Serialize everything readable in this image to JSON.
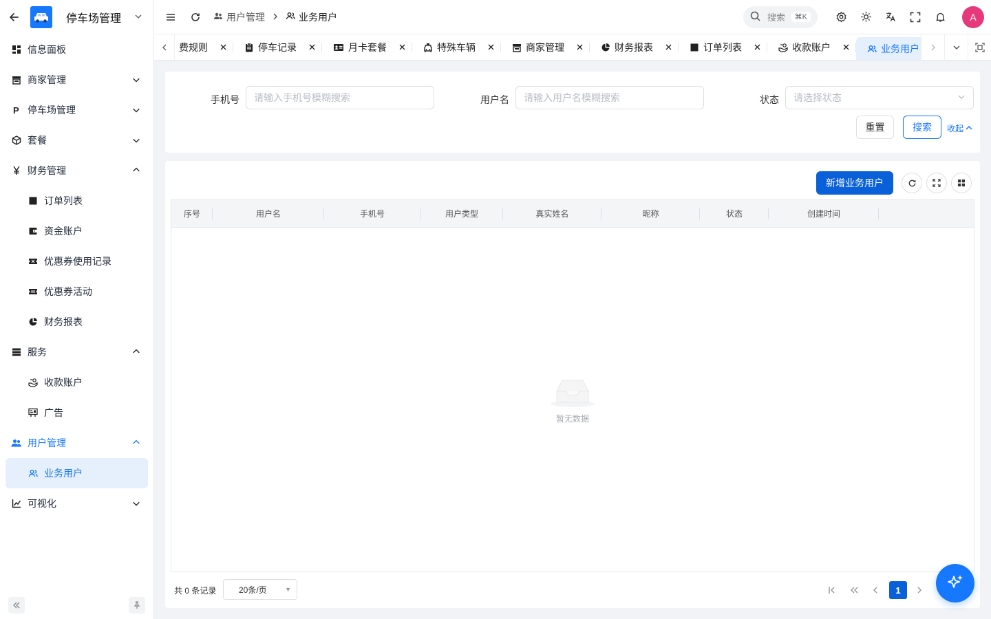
{
  "app": {
    "title": "停车场管理"
  },
  "sidebar": {
    "items": [
      {
        "label": "信息面板",
        "icon": "dashboard-icon"
      },
      {
        "label": "商家管理",
        "icon": "store-icon",
        "expandable": true,
        "expanded": false
      },
      {
        "label": "停车场管理",
        "icon": "parking-icon",
        "expandable": true,
        "expanded": false
      },
      {
        "label": "套餐",
        "icon": "package-icon",
        "expandable": true,
        "expanded": false
      },
      {
        "label": "财务管理",
        "icon": "yuan-icon",
        "expandable": true,
        "expanded": true
      },
      {
        "label": "订单列表",
        "icon": "square-icon",
        "sub": true
      },
      {
        "label": "资金账户",
        "icon": "wallet-icon",
        "sub": true
      },
      {
        "label": "优惠券使用记录",
        "icon": "ticket-icon",
        "sub": true
      },
      {
        "label": "优惠券活动",
        "icon": "coupon-icon",
        "sub": true
      },
      {
        "label": "财务报表",
        "icon": "pie-chart-icon",
        "sub": true
      },
      {
        "label": "服务",
        "icon": "server-icon",
        "expandable": true,
        "expanded": true
      },
      {
        "label": "收款账户",
        "icon": "payment-icon",
        "sub": true
      },
      {
        "label": "广告",
        "icon": "billboard-icon",
        "sub": true
      },
      {
        "label": "用户管理",
        "icon": "users-icon",
        "expandable": true,
        "expanded": true,
        "active_parent": true
      },
      {
        "label": "业务用户",
        "icon": "user-group-icon",
        "sub": true,
        "active": true
      },
      {
        "label": "可视化",
        "icon": "chart-icon",
        "expandable": true,
        "expanded": false
      }
    ]
  },
  "header": {
    "breadcrumbs": [
      "用户管理",
      "业务用户"
    ],
    "search_label": "搜索",
    "search_shortcut": "⌘K",
    "avatar_letter": "A"
  },
  "tabs": [
    {
      "label": "费规则",
      "icon": ""
    },
    {
      "label": "停车记录",
      "icon": "clipboard-icon"
    },
    {
      "label": "月卡套餐",
      "icon": "card-icon"
    },
    {
      "label": "特殊车辆",
      "icon": "car-icon"
    },
    {
      "label": "商家管理",
      "icon": "store-icon"
    },
    {
      "label": "财务报表",
      "icon": "pie-chart-icon"
    },
    {
      "label": "订单列表",
      "icon": "square-icon"
    },
    {
      "label": "收款账户",
      "icon": "payment-icon"
    },
    {
      "label": "业务用户",
      "icon": "user-group-icon",
      "active": true
    }
  ],
  "filters": {
    "phone_label": "手机号",
    "phone_placeholder": "请输入手机号模糊搜索",
    "username_label": "用户名",
    "username_placeholder": "请输入用户名模糊搜索",
    "status_label": "状态",
    "status_placeholder": "请选择状态",
    "reset_label": "重置",
    "search_label": "搜索",
    "collapse_label": "收起"
  },
  "table": {
    "add_button": "新增业务用户",
    "columns": [
      "序号",
      "用户名",
      "手机号",
      "用户类型",
      "真实姓名",
      "昵称",
      "状态",
      "创建时间",
      ""
    ],
    "empty_text": "暂无数据"
  },
  "pagination": {
    "total_text": "共 0 条记录",
    "page_size": "20条/页",
    "current_page": "1"
  },
  "colors": {
    "primary": "#1677ff",
    "primary_dark": "#0960d8",
    "avatar": "#e6397b"
  }
}
